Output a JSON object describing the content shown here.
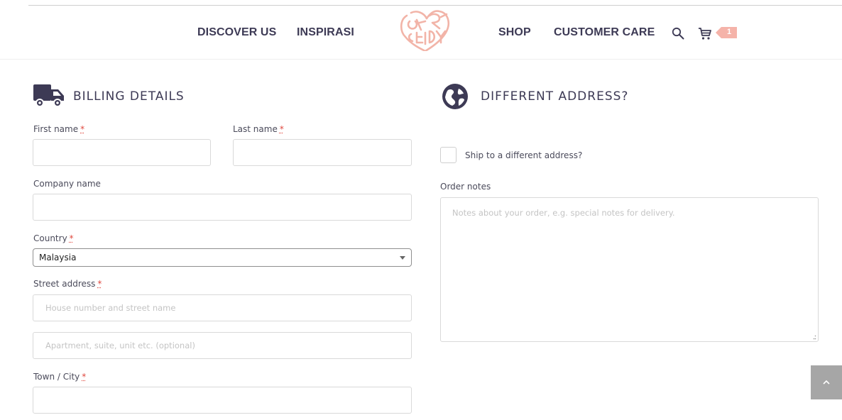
{
  "header": {
    "nav": {
      "discover": "DISCOVER US",
      "inspirasi": "INSPIRASI",
      "shop": "SHOP",
      "customer_care": "CUSTOMER CARE"
    },
    "cart_count": "1",
    "icons": {
      "search": "search-icon",
      "cart": "cart-icon",
      "logo": "brand-logo"
    }
  },
  "billing": {
    "title": "BILLING DETAILS",
    "icon": "truck-icon",
    "required_mark": "*",
    "first_name": {
      "label": "First name",
      "value": ""
    },
    "last_name": {
      "label": "Last name",
      "value": ""
    },
    "company": {
      "label": "Company name",
      "value": ""
    },
    "country": {
      "label": "Country",
      "value": "Malaysia"
    },
    "street": {
      "label": "Street address",
      "placeholder1": "House number and street name",
      "placeholder2": "Apartment, suite, unit etc. (optional)"
    },
    "town": {
      "label": "Town / City",
      "value": ""
    }
  },
  "shipping": {
    "title": "DIFFERENT ADDRESS?",
    "icon": "globe-icon",
    "ship_label": "Ship to a different address?",
    "ship_checked": false,
    "notes_label": "Order notes",
    "notes_placeholder": "Notes about your order, e.g. special notes for delivery."
  },
  "colors": {
    "brand_navy": "#3d3a55",
    "accent_pink": "#f5b3a9",
    "required_red": "#e0483e",
    "scroll_button": "#a6a6a6"
  }
}
